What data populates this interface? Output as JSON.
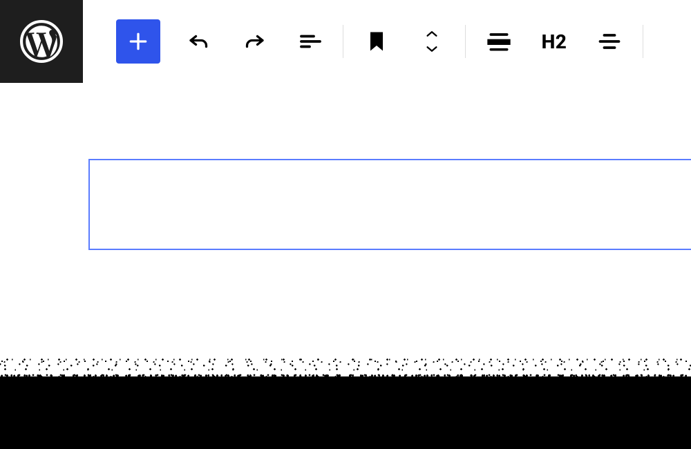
{
  "toolbar": {
    "heading_level": "H2"
  },
  "icons": {
    "wordpress": "wordpress-logo",
    "add": "plus",
    "undo": "undo",
    "redo": "redo",
    "outline": "document-outline",
    "bookmark": "bookmark",
    "move_up": "chevron-up",
    "move_down": "chevron-down",
    "align": "align-center",
    "justify": "justify-center"
  }
}
